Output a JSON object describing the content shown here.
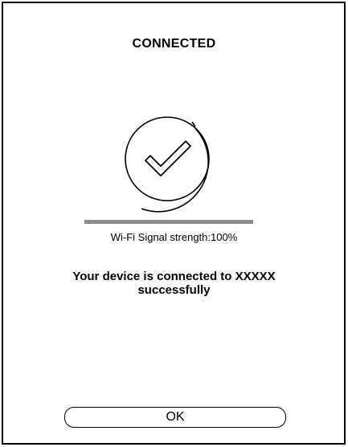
{
  "screen": {
    "title": "CONNECTED",
    "status_icon": "check-circle-icon"
  },
  "signal": {
    "label": "Wi-Fi Signal strength:100%",
    "strength": 1.0
  },
  "message": {
    "line1": "Your device is connected to  XXXXX",
    "line2": "successfully"
  },
  "actions": {
    "ok_label": "OK"
  }
}
